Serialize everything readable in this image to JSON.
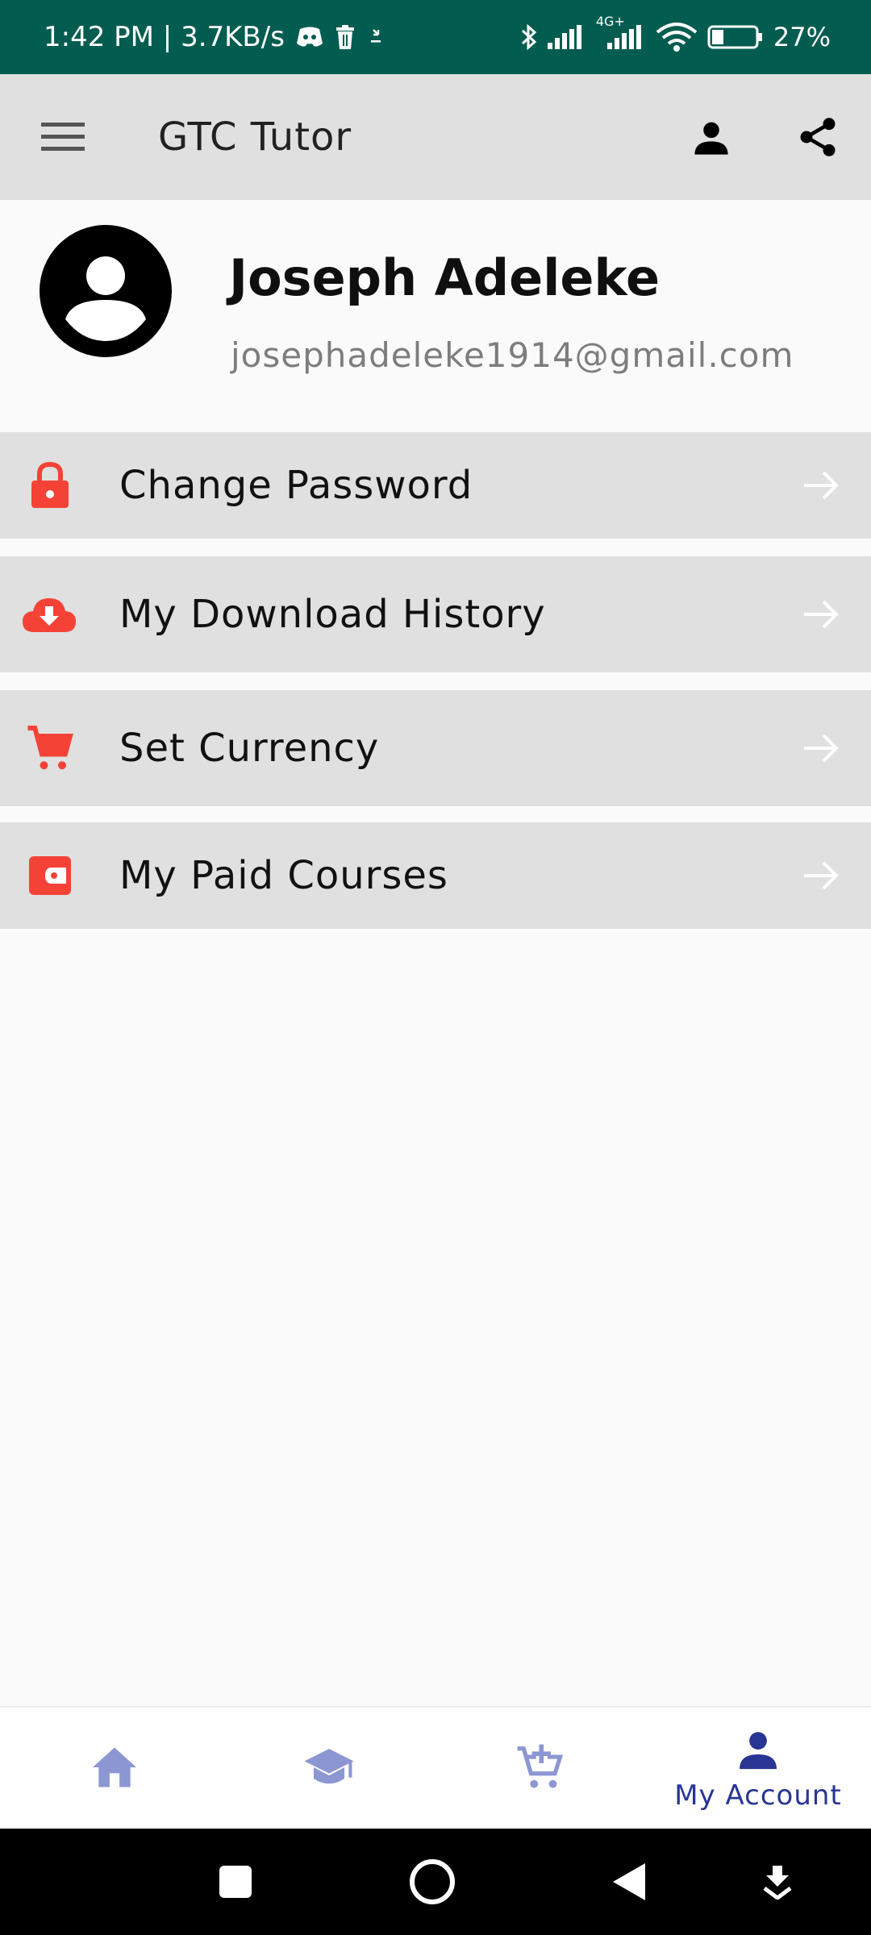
{
  "status_bar": {
    "time_speed": "1:42 PM | 3.7KB/s",
    "network_label": "4G+",
    "battery": "27%",
    "icons": [
      "discord-icon",
      "trash-icon",
      "download-icon",
      "bluetooth-icon",
      "signal-icon",
      "signal-4g-icon",
      "wifi-icon",
      "battery-icon"
    ]
  },
  "app_bar": {
    "title": "GTC Tutor",
    "icons": [
      "hamburger-menu-icon",
      "account-icon",
      "share-icon"
    ]
  },
  "profile": {
    "name": "Joseph Adeleke",
    "email": "josephadeleke1914@gmail.com"
  },
  "menu": {
    "items": [
      {
        "label": "Change Password",
        "icon": "lock-icon"
      },
      {
        "label": "My Download History",
        "icon": "cloud-download-icon"
      },
      {
        "label": "Set Currency",
        "icon": "cart-icon"
      },
      {
        "label": "My Paid Courses",
        "icon": "wallet-icon"
      }
    ]
  },
  "bottom_nav": {
    "items": [
      {
        "icon": "home-icon",
        "label": ""
      },
      {
        "icon": "graduation-cap-icon",
        "label": ""
      },
      {
        "icon": "cart-add-icon",
        "label": ""
      },
      {
        "icon": "account-icon",
        "label": "My Account",
        "active": true
      }
    ]
  },
  "colors": {
    "status_bar": "#035c50",
    "app_bar": "#e0e0e0",
    "menu_row": "#e0e0e0",
    "accent_red": "#f44336",
    "nav_inactive": "#8c96d2",
    "nav_active": "#283593"
  }
}
